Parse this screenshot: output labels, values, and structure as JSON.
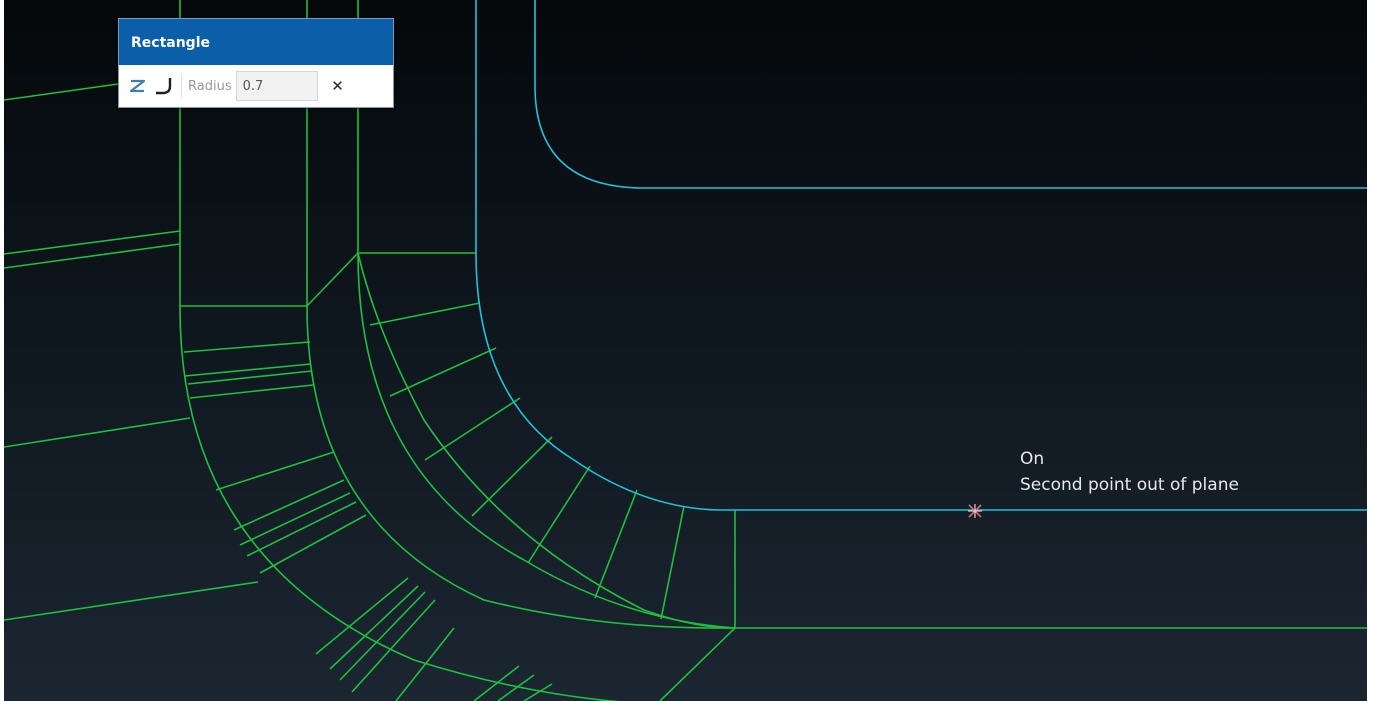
{
  "dialog": {
    "title": "Rectangle",
    "tools": [
      {
        "icon": "z-line-icon",
        "color": "#3f7fb0"
      },
      {
        "icon": "fillet-arc-icon",
        "color": "#202020"
      }
    ],
    "radius_label": "Radius",
    "radius_value": "0.7",
    "close_icon": "close-icon",
    "title_bg": "#0b5fa8"
  },
  "status": {
    "line1": "On",
    "line2": "Second point out of plane",
    "marker_icon": "snap-point-marker-icon",
    "marker_color": "#d96a6a"
  },
  "colors": {
    "mesh_edges": "#1fbf3f",
    "selected_edges": "#22c1d6",
    "background_top": "#04080b",
    "background_bottom": "#1c2631"
  }
}
